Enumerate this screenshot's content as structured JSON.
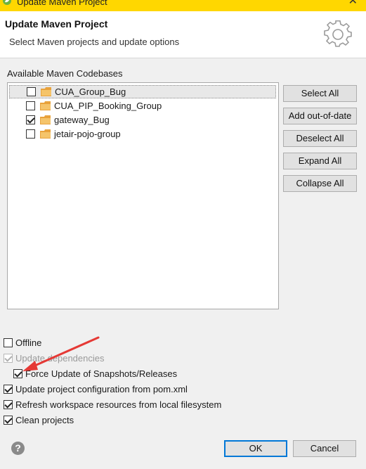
{
  "window": {
    "title": "Update Maven Project",
    "close_glyph": "✕",
    "icon": "spring-leaf-icon"
  },
  "header": {
    "title": "Update Maven Project",
    "description": "Select Maven projects and update options",
    "icon": "gear-icon"
  },
  "codebases": {
    "label": "Available Maven Codebases",
    "items": [
      {
        "label": "CUA_Group_Bug",
        "checked": false,
        "selected": true
      },
      {
        "label": "CUA_PIP_Booking_Group",
        "checked": false,
        "selected": false
      },
      {
        "label": "gateway_Bug",
        "checked": true,
        "selected": false
      },
      {
        "label": "jetair-pojo-group",
        "checked": false,
        "selected": false
      }
    ]
  },
  "buttons": {
    "select_all": "Select All",
    "add_out_of_date": "Add out-of-date",
    "deselect_all": "Deselect All",
    "expand_all": "Expand All",
    "collapse_all": "Collapse All"
  },
  "options": [
    {
      "label": "Offline",
      "checked": false,
      "enabled": true
    },
    {
      "label": "Update dependencies",
      "checked": true,
      "enabled": false
    },
    {
      "label": "Force Update of Snapshots/Releases",
      "checked": true,
      "enabled": true
    },
    {
      "label": "Update project configuration from pom.xml",
      "checked": true,
      "enabled": true
    },
    {
      "label": "Refresh workspace resources from local filesystem",
      "checked": true,
      "enabled": true
    },
    {
      "label": "Clean projects",
      "checked": true,
      "enabled": true
    }
  ],
  "footer": {
    "help_glyph": "?",
    "ok": "OK",
    "cancel": "Cancel"
  },
  "colors": {
    "title_bar": "#ffd700",
    "annotation_arrow": "#e53935",
    "default_button_border": "#0078d7"
  }
}
